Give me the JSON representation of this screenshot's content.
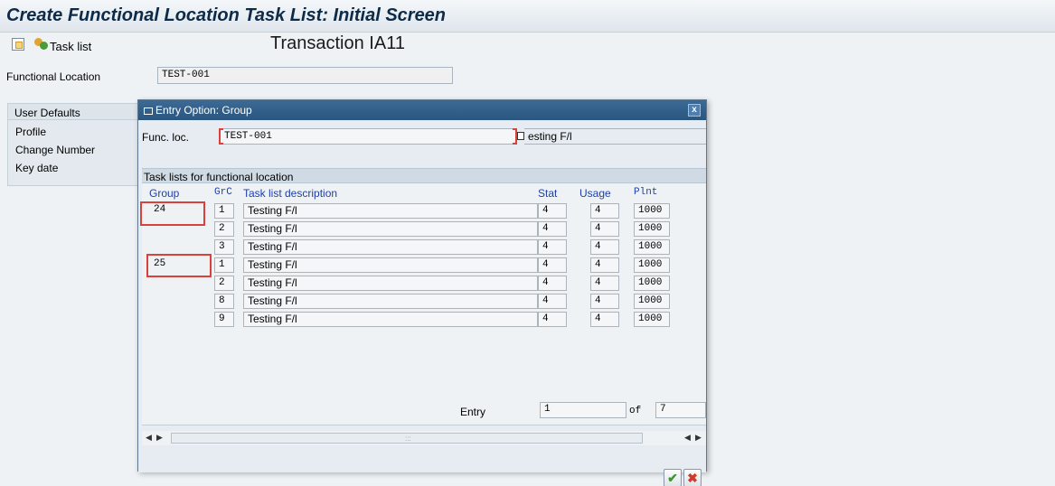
{
  "window": {
    "title": "Create Functional Location Task List: Initial Screen"
  },
  "toolbar": {
    "task_list_label": "Task list"
  },
  "annotation": {
    "text": "Transaction IA11"
  },
  "main_form": {
    "functional_location_label": "Functional Location",
    "functional_location_value": "TEST-001"
  },
  "user_defaults": {
    "header": "User Defaults",
    "rows": [
      "Profile",
      "Change Number",
      "Key date"
    ]
  },
  "dialog": {
    "title": "Entry Option: Group",
    "close_label": "x",
    "func_loc_label": "Func. loc.",
    "func_loc_value": "TEST-001",
    "func_loc_desc": "esting F/l",
    "section_header": "Task lists for functional location",
    "columns": {
      "group": "Group",
      "grc": "GrC",
      "desc": "Task list description",
      "stat": "Stat",
      "usage": "Usage",
      "plnt": "Plnt"
    },
    "rows": [
      {
        "group": "24",
        "grc": "1",
        "desc": "Testing F/l",
        "stat": "4",
        "usage": "4",
        "plnt": "1000"
      },
      {
        "group": "",
        "grc": "2",
        "desc": "Testing F/l",
        "stat": "4",
        "usage": "4",
        "plnt": "1000"
      },
      {
        "group": "",
        "grc": "3",
        "desc": "Testing F/l",
        "stat": "4",
        "usage": "4",
        "plnt": "1000"
      },
      {
        "group": "25",
        "grc": "1",
        "desc": "Testing F/l",
        "stat": "4",
        "usage": "4",
        "plnt": "1000"
      },
      {
        "group": "",
        "grc": "2",
        "desc": "Testing F/l",
        "stat": "4",
        "usage": "4",
        "plnt": "1000"
      },
      {
        "group": "",
        "grc": "8",
        "desc": "Testing F/l",
        "stat": "4",
        "usage": "4",
        "plnt": "1000"
      },
      {
        "group": "",
        "grc": "9",
        "desc": "Testing F/l",
        "stat": "4",
        "usage": "4",
        "plnt": "1000"
      }
    ],
    "entry_label": "Entry",
    "entry_value": "1",
    "of_label": "of",
    "total_value": "7",
    "ok_label": "✔",
    "cancel_label": "✖"
  },
  "colors": {
    "title_bar": "#2a5680",
    "header_text": "#1f3fa8",
    "highlight": "#d9413a"
  }
}
